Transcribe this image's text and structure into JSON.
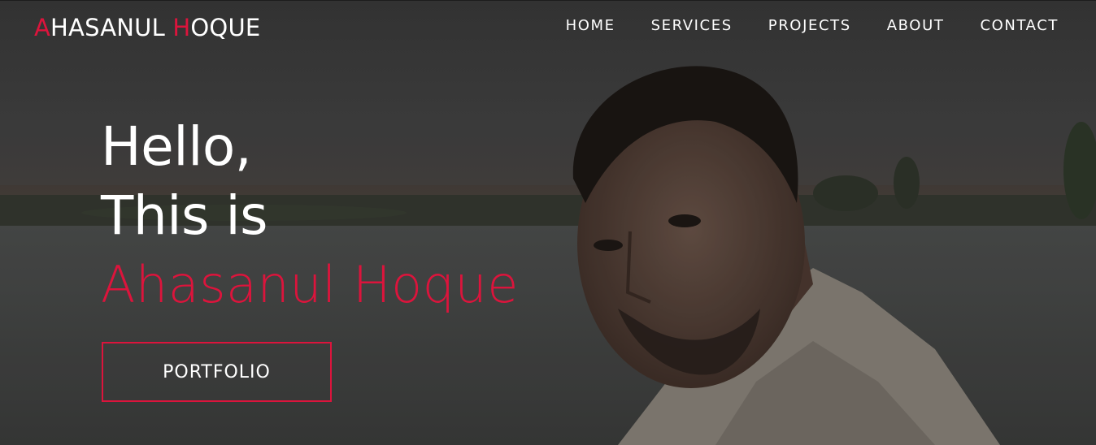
{
  "logo": {
    "first_initial": "A",
    "first_rest": "HASANUL ",
    "second_initial": "H",
    "second_rest": "OQUE"
  },
  "nav": {
    "items": [
      {
        "label": "HOME"
      },
      {
        "label": "SERVICES"
      },
      {
        "label": "PROJECTS"
      },
      {
        "label": "ABOUT"
      },
      {
        "label": "CONTACT"
      }
    ]
  },
  "hero": {
    "greeting": "Hello,",
    "intro": "This is",
    "name": "Ahasanul Hoque",
    "button_label": "PORTFOLIO"
  },
  "colors": {
    "accent": "#dc143c",
    "text": "#ffffff"
  }
}
